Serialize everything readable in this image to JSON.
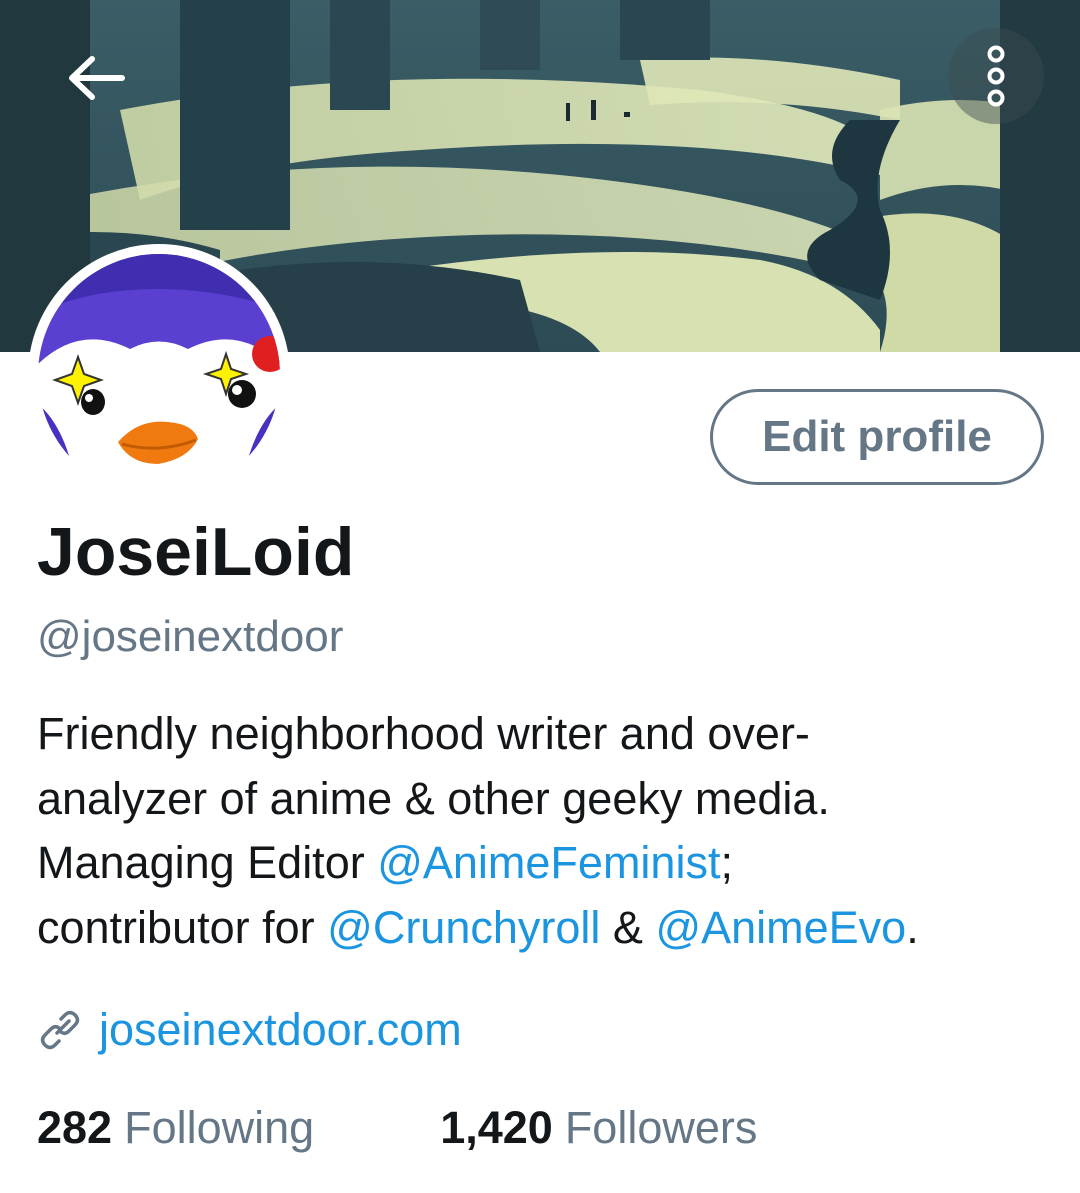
{
  "header": {
    "back_icon": "arrow-left-icon",
    "more_icon": "vertical-ellipsis-icon",
    "banner_alt": "Snowy forest landscape with winding creek"
  },
  "profile": {
    "display_name": "JoseiLoid",
    "handle": "@joseinextdoor",
    "edit_button_label": "Edit profile",
    "bio": {
      "line1": "Friendly neighborhood writer and over-",
      "line2": "analyzer of anime & other geeky media.",
      "line3_text": "Managing Editor ",
      "line3_mention": "@AnimeFeminist",
      "line3_end": ";",
      "line4_text": "contributor for ",
      "line4_mention1": "@Crunchyroll",
      "line4_mid": " & ",
      "line4_mention2": "@AnimeEvo",
      "line4_end": "."
    },
    "website": {
      "icon": "link-icon",
      "url": "joseinextdoor.com"
    },
    "stats": {
      "following_count": "282",
      "following_label": "Following",
      "followers_count": "1,420",
      "followers_label": "Followers"
    }
  },
  "colors": {
    "link": "#1b95e0",
    "secondary_text": "#657786",
    "primary_text": "#14171a"
  }
}
